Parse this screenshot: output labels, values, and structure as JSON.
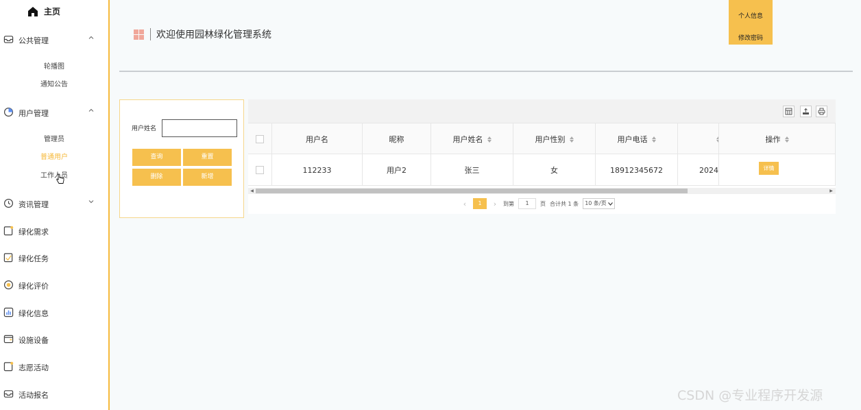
{
  "sidebar": {
    "home_label": "主页",
    "groups": [
      {
        "label": "公共管理",
        "icon": "inbox-icon",
        "expanded": true,
        "items": [
          "轮播图",
          "通知公告"
        ]
      },
      {
        "label": "用户管理",
        "icon": "user-circle-icon",
        "expanded": true,
        "items": [
          "管理员",
          "普通用户",
          "工作人员"
        ],
        "active_item": "普通用户"
      },
      {
        "label": "资讯管理",
        "icon": "circle-clock-icon",
        "expanded": false
      }
    ],
    "menu_items": [
      "绿化需求",
      "绿化任务",
      "绿化评价",
      "绿化信息",
      "设施设备",
      "志愿活动",
      "活动报名"
    ]
  },
  "header": {
    "title": "欢迎使用园林绿化管理系统",
    "user_menu": [
      "个人信息",
      "修改密码"
    ]
  },
  "search": {
    "label": "用户姓名",
    "value": "",
    "buttons": [
      "查询",
      "重置",
      "删除",
      "新增"
    ]
  },
  "table": {
    "columns": [
      "用户名",
      "昵称",
      "用户姓名",
      "用户性别",
      "用户电话",
      "",
      "操作"
    ],
    "rows": [
      {
        "username": "112233",
        "nickname": "用户2",
        "realname": "张三",
        "gender": "女",
        "phone": "18912345672",
        "created": "2024",
        "action": "详情"
      }
    ]
  },
  "pagination": {
    "current_page": "1",
    "goto_label": "到第",
    "goto_value": "1",
    "page_unit": "页",
    "total_text": "合计共 1 条",
    "page_size": "10 条/页"
  },
  "watermark": "CSDN @专业程序开发源",
  "colors": {
    "accent": "#f6c04e",
    "sidebar_border": "#f6b93b"
  }
}
